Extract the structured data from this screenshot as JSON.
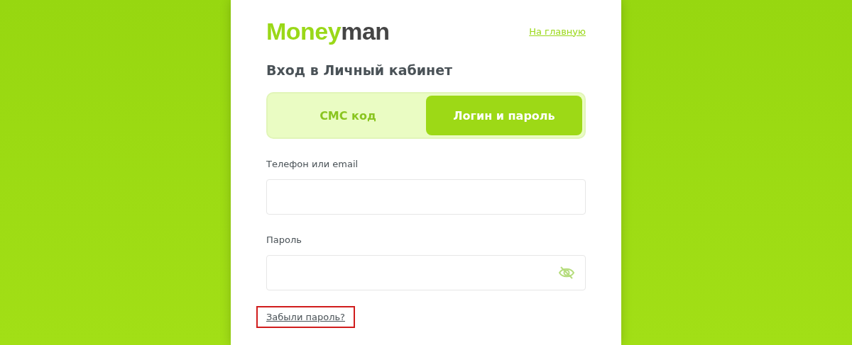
{
  "logo": {
    "accent": "Money",
    "rest": "man"
  },
  "home_link": "На главную",
  "heading": "Вход в Личный кабинет",
  "tabs": [
    {
      "label": "СМС код",
      "selected": false
    },
    {
      "label": "Логин и пароль",
      "selected": true
    }
  ],
  "fields": [
    {
      "label": "Телефон или email",
      "kind": "text"
    },
    {
      "label": "Пароль",
      "kind": "password"
    }
  ],
  "forgot_link": {
    "text": "Забыли пароль?",
    "highlighted": true
  }
}
